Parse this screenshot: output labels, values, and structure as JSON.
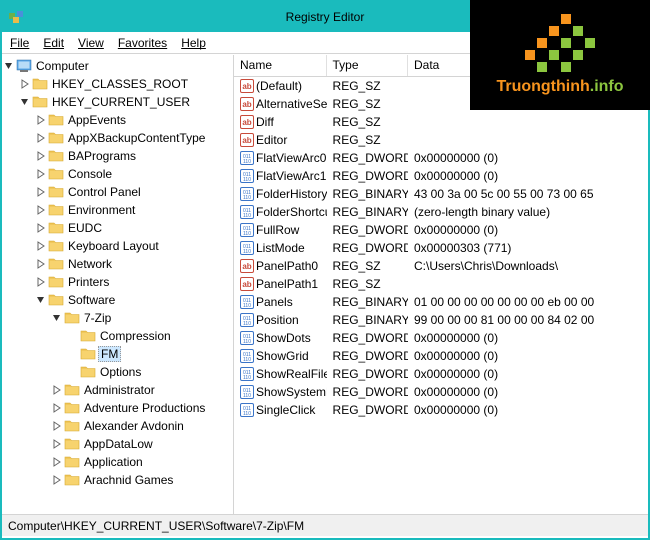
{
  "window": {
    "title": "Registry Editor"
  },
  "logo": {
    "text1": "Truongthinh",
    "text2": ".info"
  },
  "menu": {
    "file": "File",
    "edit": "Edit",
    "view": "View",
    "favorites": "Favorites",
    "help": "Help"
  },
  "tree": {
    "root": "Computer",
    "hkcr": "HKEY_CLASSES_ROOT",
    "hkcu": "HKEY_CURRENT_USER",
    "items": [
      "AppEvents",
      "AppXBackupContentType",
      "BAPrograms",
      "Console",
      "Control Panel",
      "Environment",
      "EUDC",
      "Keyboard Layout",
      "Network",
      "Printers",
      "Software"
    ],
    "sevenzip": "7-Zip",
    "sevenzip_children": [
      "Compression",
      "FM",
      "Options"
    ],
    "software_rest": [
      "Administrator",
      "Adventure Productions",
      "Alexander Avdonin",
      "AppDataLow",
      "Application",
      "Arachnid Games"
    ]
  },
  "columns": {
    "name": "Name",
    "type": "Type",
    "data": "Data"
  },
  "values": [
    {
      "icon": "sz",
      "name": "(Default)",
      "type": "REG_SZ",
      "data": ""
    },
    {
      "icon": "sz",
      "name": "AlternativeSelec...",
      "type": "REG_SZ",
      "data": ""
    },
    {
      "icon": "sz",
      "name": "Diff",
      "type": "REG_SZ",
      "data": ""
    },
    {
      "icon": "sz",
      "name": "Editor",
      "type": "REG_SZ",
      "data": ""
    },
    {
      "icon": "bin",
      "name": "FlatViewArc0",
      "type": "REG_DWORD",
      "data": "0x00000000 (0)"
    },
    {
      "icon": "bin",
      "name": "FlatViewArc1",
      "type": "REG_DWORD",
      "data": "0x00000000 (0)"
    },
    {
      "icon": "bin",
      "name": "FolderHistory",
      "type": "REG_BINARY",
      "data": "43 00 3a 00 5c 00 55 00 73 00 65"
    },
    {
      "icon": "bin",
      "name": "FolderShortcuts",
      "type": "REG_BINARY",
      "data": "(zero-length binary value)"
    },
    {
      "icon": "bin",
      "name": "FullRow",
      "type": "REG_DWORD",
      "data": "0x00000000 (0)"
    },
    {
      "icon": "bin",
      "name": "ListMode",
      "type": "REG_DWORD",
      "data": "0x00000303 (771)"
    },
    {
      "icon": "sz",
      "name": "PanelPath0",
      "type": "REG_SZ",
      "data": "C:\\Users\\Chris\\Downloads\\"
    },
    {
      "icon": "sz",
      "name": "PanelPath1",
      "type": "REG_SZ",
      "data": ""
    },
    {
      "icon": "bin",
      "name": "Panels",
      "type": "REG_BINARY",
      "data": "01 00 00 00 00 00 00 00 eb 00 00"
    },
    {
      "icon": "bin",
      "name": "Position",
      "type": "REG_BINARY",
      "data": "99 00 00 00 81 00 00 00 84 02 00"
    },
    {
      "icon": "bin",
      "name": "ShowDots",
      "type": "REG_DWORD",
      "data": "0x00000000 (0)"
    },
    {
      "icon": "bin",
      "name": "ShowGrid",
      "type": "REG_DWORD",
      "data": "0x00000000 (0)"
    },
    {
      "icon": "bin",
      "name": "ShowRealFileIco...",
      "type": "REG_DWORD",
      "data": "0x00000000 (0)"
    },
    {
      "icon": "bin",
      "name": "ShowSystemMe...",
      "type": "REG_DWORD",
      "data": "0x00000000 (0)"
    },
    {
      "icon": "bin",
      "name": "SingleClick",
      "type": "REG_DWORD",
      "data": "0x00000000 (0)"
    }
  ],
  "statusbar": {
    "path": "Computer\\HKEY_CURRENT_USER\\Software\\7-Zip\\FM"
  }
}
